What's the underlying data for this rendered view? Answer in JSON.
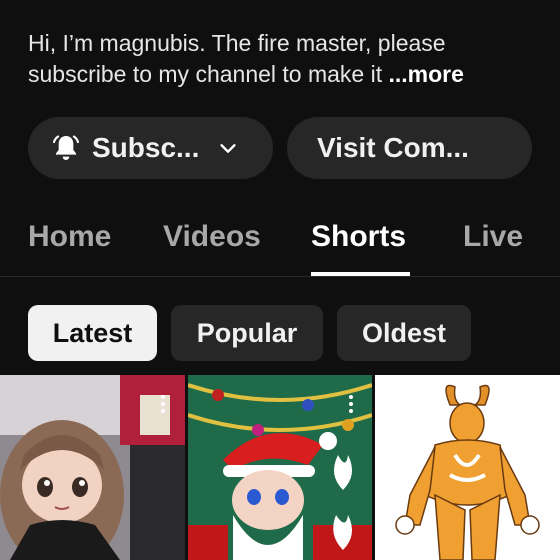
{
  "channel": {
    "description_line1": "Hi, I’m magnubis. The fire master, please",
    "description_line2": "subscribe to my channel  to make it",
    "more_label": "...more"
  },
  "buttons": {
    "subscribe_label": "Subsc...",
    "visit_label": "Visit Com..."
  },
  "tabs": [
    {
      "label": "Home"
    },
    {
      "label": "Videos"
    },
    {
      "label": "Shorts",
      "active": true
    },
    {
      "label": "Live"
    }
  ],
  "filters": [
    {
      "label": "Latest",
      "active": true
    },
    {
      "label": "Popular"
    },
    {
      "label": "Oldest"
    }
  ],
  "shorts": [
    {
      "thumbnail": "anime-girl-brown-hair"
    },
    {
      "thumbnail": "santa-character-christmas-tree"
    },
    {
      "thumbnail": "orange-horned-demon-figure"
    }
  ],
  "colors": {
    "background": "#0f0f0f",
    "pill": "#272727",
    "active_chip": "#f1f1f1",
    "inactive_tab": "#a8a8a8"
  },
  "icons": {
    "subscribe": "bell-icon",
    "dropdown": "chevron-down-icon",
    "menu": "more-vert-icon"
  }
}
